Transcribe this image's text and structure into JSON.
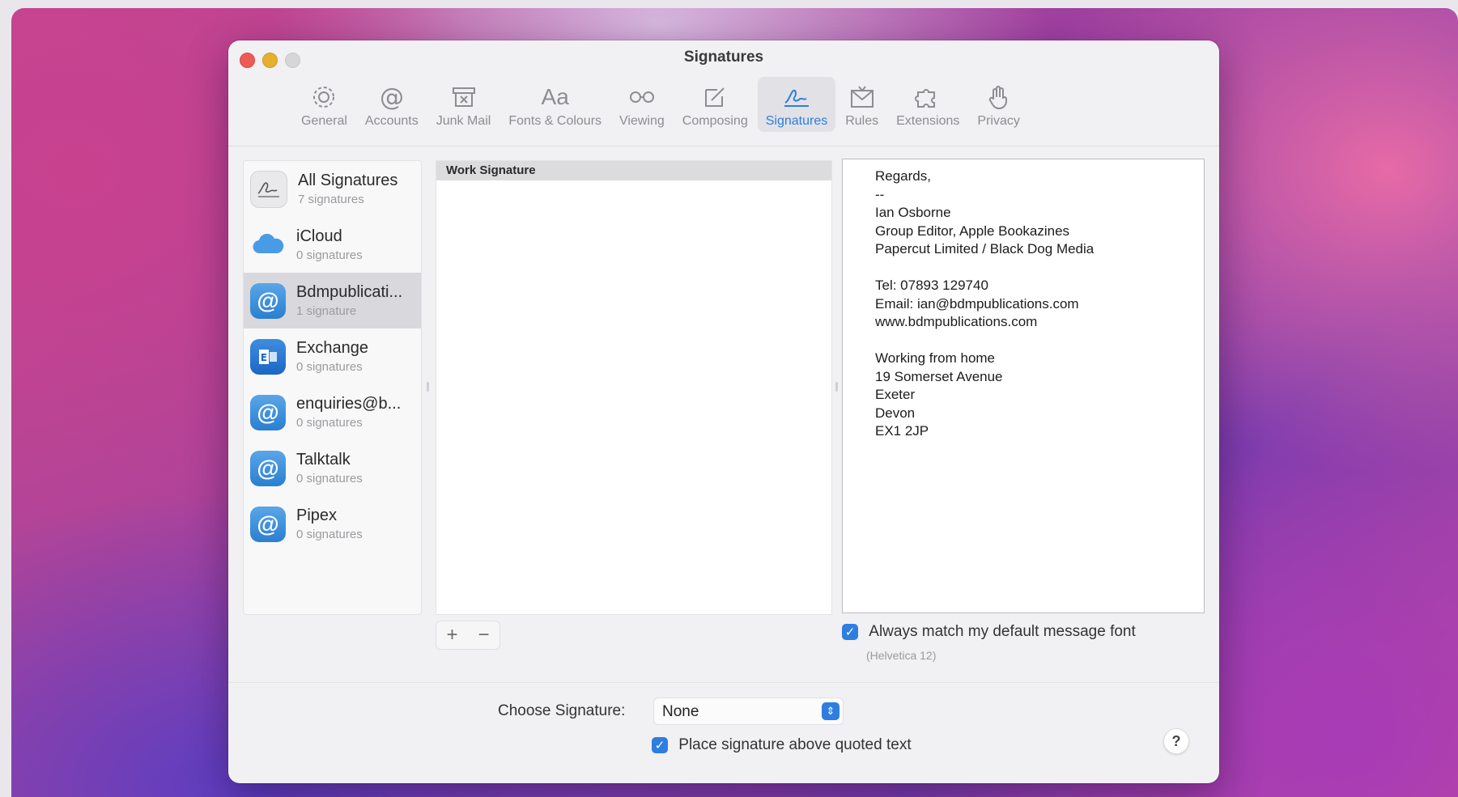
{
  "window": {
    "title": "Signatures"
  },
  "toolbar": {
    "items": [
      {
        "label": "General",
        "icon": "gear-icon"
      },
      {
        "label": "Accounts",
        "icon": "at-icon"
      },
      {
        "label": "Junk Mail",
        "icon": "junk-tray-icon"
      },
      {
        "label": "Fonts & Colours",
        "icon": "font-icon",
        "glyph": "Aa"
      },
      {
        "label": "Viewing",
        "icon": "glasses-icon"
      },
      {
        "label": "Composing",
        "icon": "compose-icon"
      },
      {
        "label": "Signatures",
        "icon": "signature-icon",
        "active": true
      },
      {
        "label": "Rules",
        "icon": "rules-envelope-icon"
      },
      {
        "label": "Extensions",
        "icon": "puzzle-icon"
      },
      {
        "label": "Privacy",
        "icon": "hand-icon"
      }
    ],
    "active_color": "#2f7de0"
  },
  "accounts": [
    {
      "name": "All Signatures",
      "count": "7 signatures",
      "icon": "signature-stack-icon"
    },
    {
      "name": "iCloud",
      "count": "0 signatures",
      "icon": "cloud-icon"
    },
    {
      "name": "Bdmpublicati...",
      "count": "1 signature",
      "icon": "at-icon",
      "selected": true
    },
    {
      "name": "Exchange",
      "count": "0 signatures",
      "icon": "exchange-icon"
    },
    {
      "name": "enquiries@b...",
      "count": "0 signatures",
      "icon": "at-icon"
    },
    {
      "name": "Talktalk",
      "count": "0 signatures",
      "icon": "at-icon"
    },
    {
      "name": "Pipex",
      "count": "0 signatures",
      "icon": "at-icon"
    }
  ],
  "signatures": {
    "items": [
      "Work Signature"
    ],
    "add_label": "+",
    "remove_label": "−"
  },
  "preview": {
    "text": "Regards,\n--\nIan Osborne\nGroup Editor, Apple Bookazines\nPapercut Limited / Black Dog Media\n\nTel: 07893 129740\nEmail: ian@bdmpublications.com\nwww.bdmpublications.com\n\nWorking from home\n19 Somerset Avenue\nExeter\nDevon\nEX1 2JP"
  },
  "options": {
    "match_font_label": "Always match my default message font",
    "match_font_checked": true,
    "font_note": "(Helvetica 12)",
    "choose_label": "Choose Signature:",
    "choose_value": "None",
    "place_above_label": "Place signature above quoted text",
    "place_above_checked": true,
    "help_label": "?",
    "checkmark": "✓",
    "popup_arrows": "⇕"
  }
}
